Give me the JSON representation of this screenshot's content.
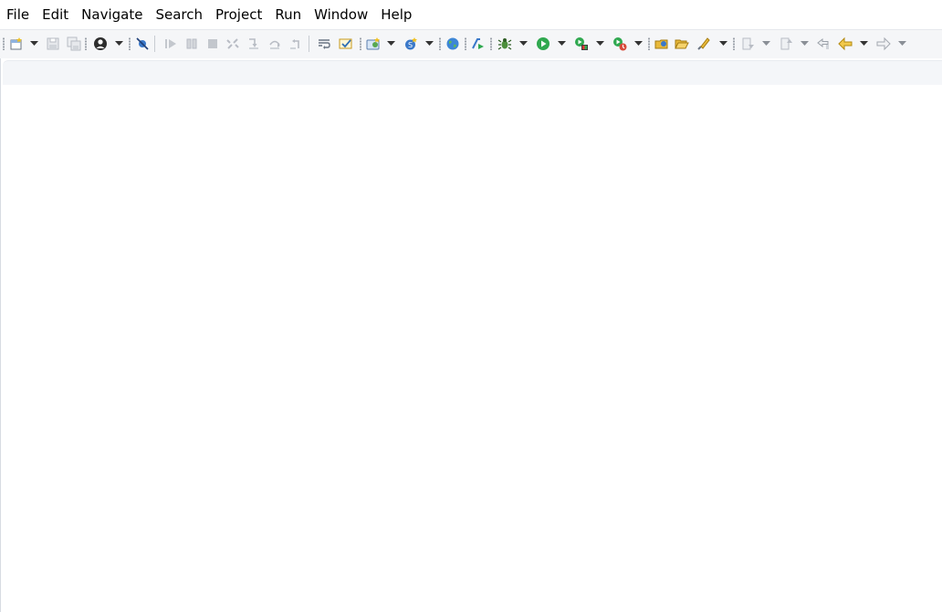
{
  "menu": {
    "items": [
      "File",
      "Edit",
      "Navigate",
      "Search",
      "Project",
      "Run",
      "Window",
      "Help"
    ]
  },
  "toolbar": {
    "buttons": [
      {
        "name": "new-icon",
        "enabled": true
      },
      {
        "name": "save-icon",
        "enabled": false
      },
      {
        "name": "save-all-icon",
        "enabled": false
      },
      {
        "name": "user-icon",
        "enabled": true
      },
      {
        "name": "skip-breakpoints-icon",
        "enabled": true
      },
      {
        "name": "resume-icon",
        "enabled": false
      },
      {
        "name": "suspend-icon",
        "enabled": false
      },
      {
        "name": "terminate-icon",
        "enabled": false
      },
      {
        "name": "disconnect-icon",
        "enabled": false
      },
      {
        "name": "step-into-icon",
        "enabled": false
      },
      {
        "name": "step-over-icon",
        "enabled": false
      },
      {
        "name": "step-return-icon",
        "enabled": false
      },
      {
        "name": "word-wrap-icon",
        "enabled": true
      },
      {
        "name": "toggle-mark-icon",
        "enabled": true
      },
      {
        "name": "new-server-icon",
        "enabled": true
      },
      {
        "name": "new-script-icon",
        "enabled": true
      },
      {
        "name": "globe-icon",
        "enabled": true
      },
      {
        "name": "run-server-icon",
        "enabled": true
      },
      {
        "name": "debug-icon",
        "enabled": true
      },
      {
        "name": "run-icon",
        "enabled": true
      },
      {
        "name": "coverage-icon",
        "enabled": true
      },
      {
        "name": "profile-icon",
        "enabled": true
      },
      {
        "name": "open-type-icon",
        "enabled": true
      },
      {
        "name": "open-folder-icon",
        "enabled": true
      },
      {
        "name": "open-task-icon",
        "enabled": true
      },
      {
        "name": "next-annotation-icon",
        "enabled": false
      },
      {
        "name": "previous-annotation-icon",
        "enabled": false
      },
      {
        "name": "last-edit-icon",
        "enabled": false
      },
      {
        "name": "back-icon",
        "enabled": true
      },
      {
        "name": "forward-icon",
        "enabled": false
      }
    ],
    "colors": {
      "background": "#f5f6f8",
      "accent_yellow": "#e8b93a",
      "accent_green": "#2fa84f",
      "accent_blue": "#3a78c9",
      "disabled": "#b8bcc4"
    }
  }
}
